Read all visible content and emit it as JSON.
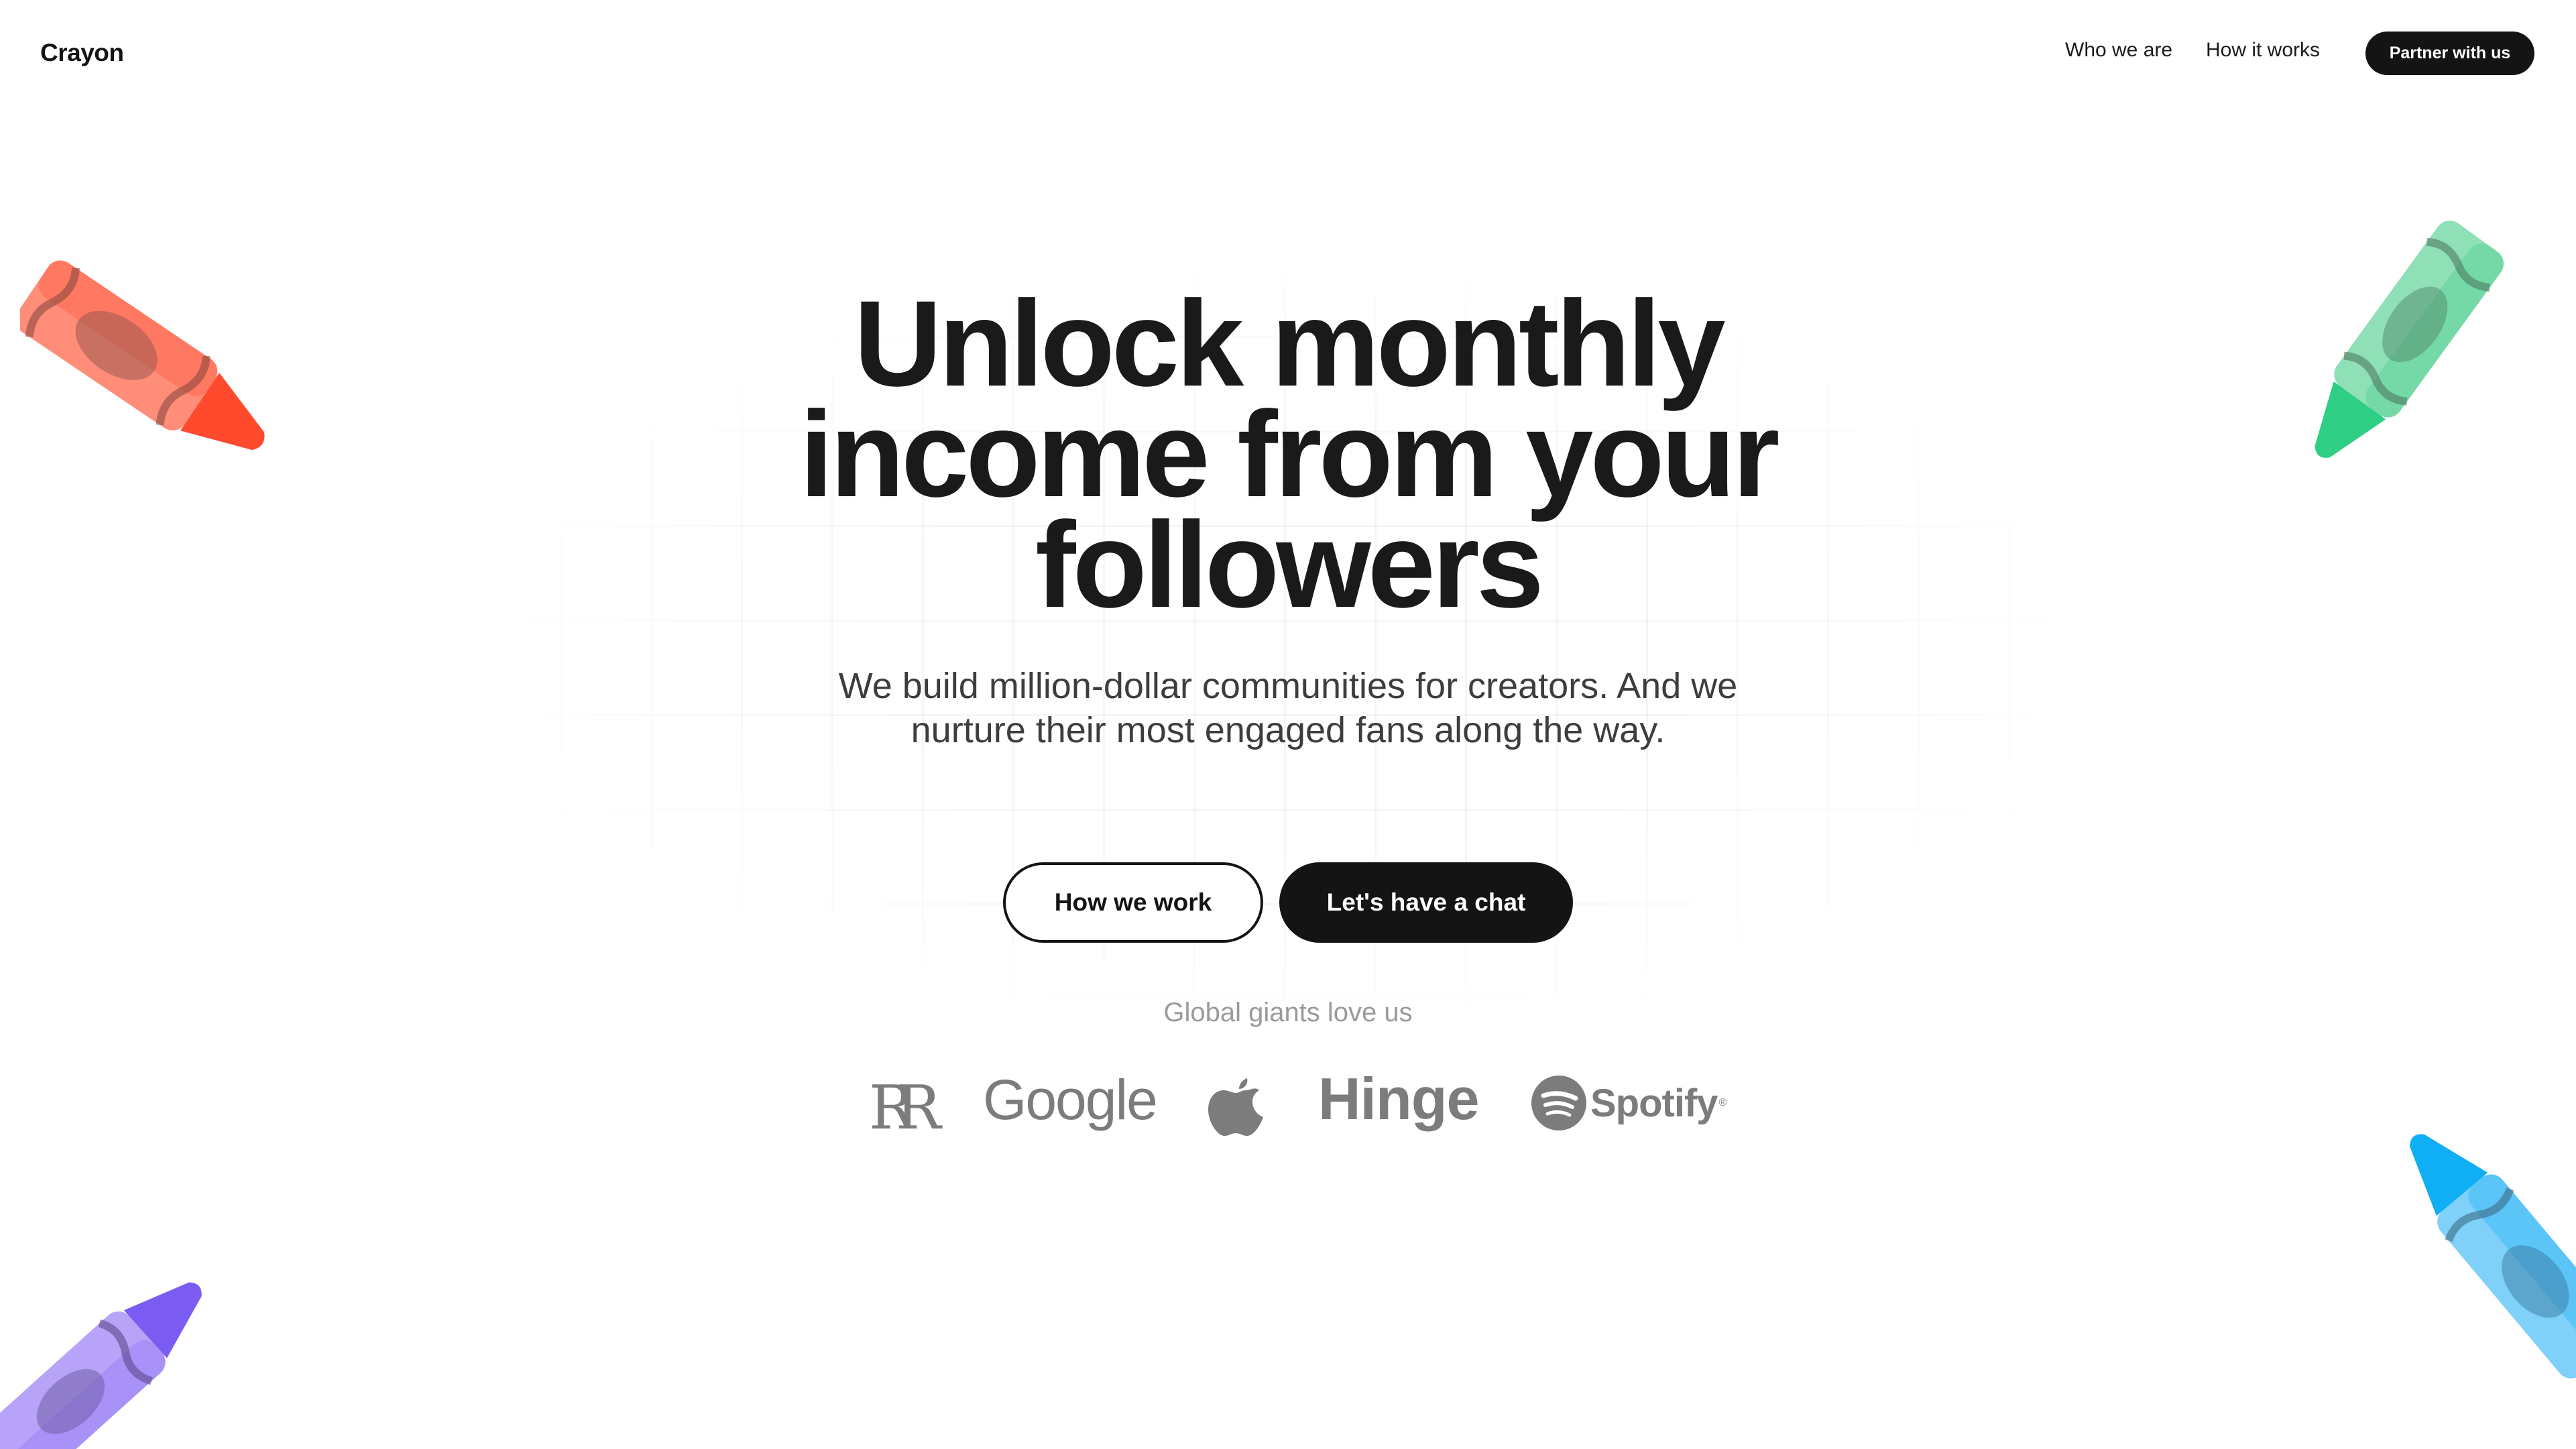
{
  "header": {
    "logo": "Crayon",
    "nav": [
      "Who we are",
      "How it works"
    ],
    "cta": "Partner with us"
  },
  "hero": {
    "headline": "Unlock monthly income from your followers",
    "subheadline": "We build million-dollar communities for creators. And we nurture their most engaged fans along the way.",
    "primary_button": "How we work",
    "secondary_button": "Let's have a chat"
  },
  "social_proof": {
    "caption": "Global giants love us",
    "brands": {
      "rolls_royce": "RR",
      "google": "Google",
      "apple": "apple-logo-icon",
      "hinge": "Hinge",
      "spotify": "Spotify",
      "spotify_mark": "®"
    }
  },
  "decorations": {
    "crayons": [
      {
        "name": "red-crayon",
        "color": "#ff4a2e"
      },
      {
        "name": "green-crayon",
        "color": "#2ecf85"
      },
      {
        "name": "purple-crayon",
        "color": "#8b6cf5"
      },
      {
        "name": "blue-crayon",
        "color": "#10aef5"
      }
    ]
  },
  "colors": {
    "dark": "#141414",
    "muted_text": "#9a9a9a",
    "logo_gray": "#7c7c7c",
    "background": "#ffffff"
  }
}
